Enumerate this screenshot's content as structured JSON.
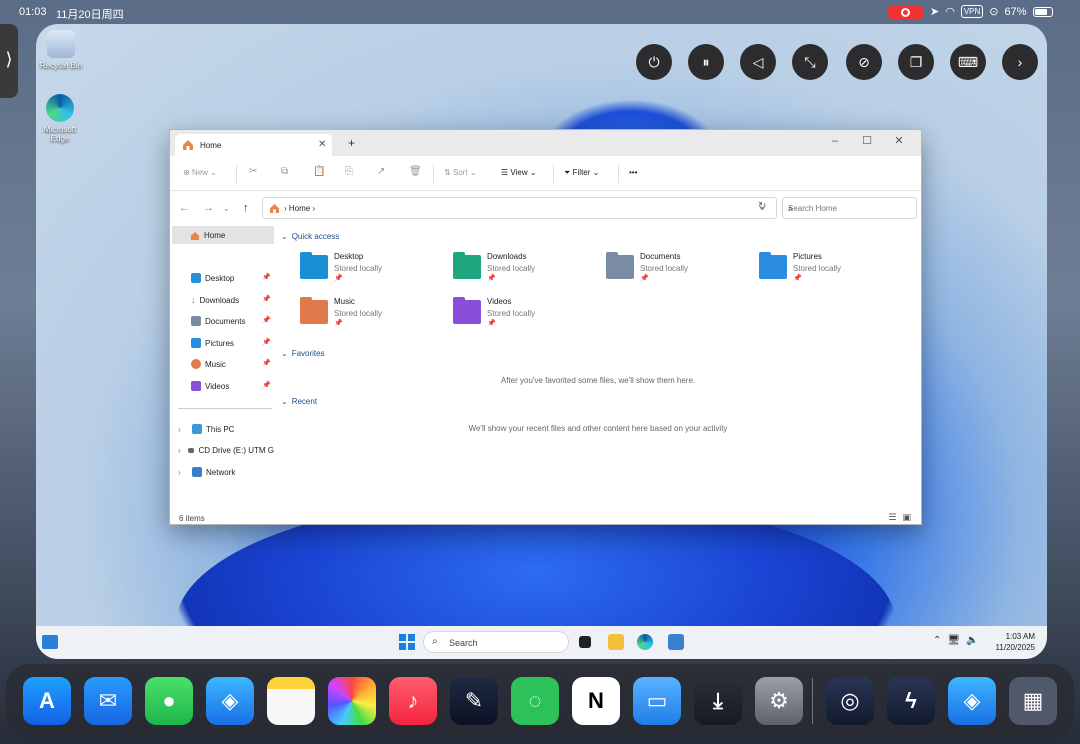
{
  "ipad_status": {
    "time": "01:03",
    "date": "11月20日周四",
    "vpn": "VPN",
    "battery": "67%"
  },
  "desktop": {
    "icons": [
      {
        "label": "Recycle Bin"
      },
      {
        "label": "Microsoft Edge"
      }
    ]
  },
  "explorer": {
    "tab_title": "Home",
    "new_label": "New",
    "sort_label": "Sort",
    "view_label": "View",
    "filter_label": "Filter",
    "more_label": "•••",
    "address": "Home",
    "search_placeholder": "Search Home",
    "sidebar": {
      "home": "Home",
      "pinned": [
        "Desktop",
        "Downloads",
        "Documents",
        "Pictures",
        "Music",
        "Videos"
      ],
      "drives": [
        "This PC",
        "CD Drive (E:) UTM G",
        "Network"
      ]
    },
    "quick_access_header": "Quick access",
    "quick_access": [
      {
        "name": "Desktop",
        "sub": "Stored locally",
        "color": "#1b8fd6"
      },
      {
        "name": "Downloads",
        "sub": "Stored locally",
        "color": "#1ea77f"
      },
      {
        "name": "Documents",
        "sub": "Stored locally",
        "color": "#7a8ca3"
      },
      {
        "name": "Pictures",
        "sub": "Stored locally",
        "color": "#2a8de0"
      },
      {
        "name": "Music",
        "sub": "Stored locally",
        "color": "#e07a4a"
      },
      {
        "name": "Videos",
        "sub": "Stored locally",
        "color": "#8a4fd8"
      }
    ],
    "favorites_header": "Favorites",
    "favorites_msg": "After you've favorited some files, we'll show them here.",
    "recent_header": "Recent",
    "recent_msg": "We'll show your recent files and other content here based on your activity",
    "status_count": "6 items"
  },
  "taskbar": {
    "search_label": "Search",
    "clock_time": "1:03 AM",
    "clock_date": "11/20/2025"
  },
  "dock_apps": [
    "App Store",
    "Mail",
    "Messages",
    "Safari",
    "Notes",
    "Photos",
    "Music",
    "Freeform",
    "WeChat",
    "Notion",
    "Files",
    "Downloader",
    "Settings",
    "UTM",
    "Shortcuts",
    "Safari",
    "App Library"
  ]
}
